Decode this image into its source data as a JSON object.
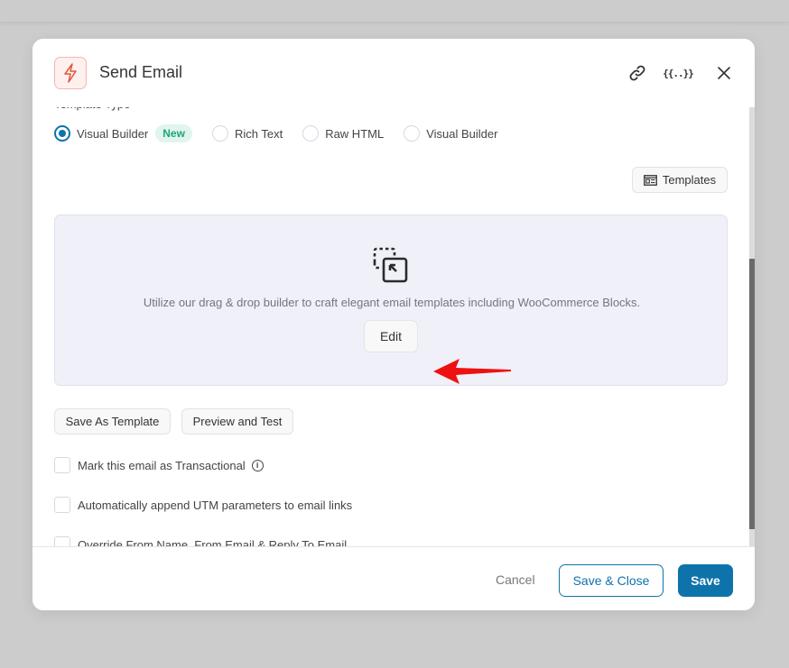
{
  "modal": {
    "title": "Send Email",
    "header_icons": [
      "bolt-icon",
      "link-icon",
      "merge-tags-icon",
      "close-icon"
    ],
    "merge_tag_glyph": "{{..}}"
  },
  "template_type": {
    "label": "Template Type",
    "options": [
      {
        "label": "Visual Builder",
        "checked": true,
        "badge": "New"
      },
      {
        "label": "Rich Text",
        "checked": false
      },
      {
        "label": "Raw HTML",
        "checked": false
      },
      {
        "label": "Visual Builder",
        "checked": false
      }
    ]
  },
  "templates_button": "Templates",
  "builder": {
    "description": "Utilize our drag & drop builder to craft elegant email templates including WooCommerce Blocks.",
    "edit_label": "Edit"
  },
  "actions": {
    "save_as_template": "Save As Template",
    "preview_and_test": "Preview and Test"
  },
  "checkboxes": [
    {
      "label": "Mark this email as Transactional",
      "checked": false,
      "info": true
    },
    {
      "label": "Automatically append UTM parameters to email links",
      "checked": false
    },
    {
      "label": "Override From Name, From Email & Reply To Email",
      "checked": false
    }
  ],
  "footer": {
    "cancel": "Cancel",
    "save_close": "Save & Close",
    "save": "Save"
  },
  "colors": {
    "primary": "#0e73aa",
    "accent_icon": "#e2553c",
    "badge_new": "#1fa37a",
    "builder_bg": "#f0f0f9",
    "annotation_arrow": "#ee1111"
  }
}
